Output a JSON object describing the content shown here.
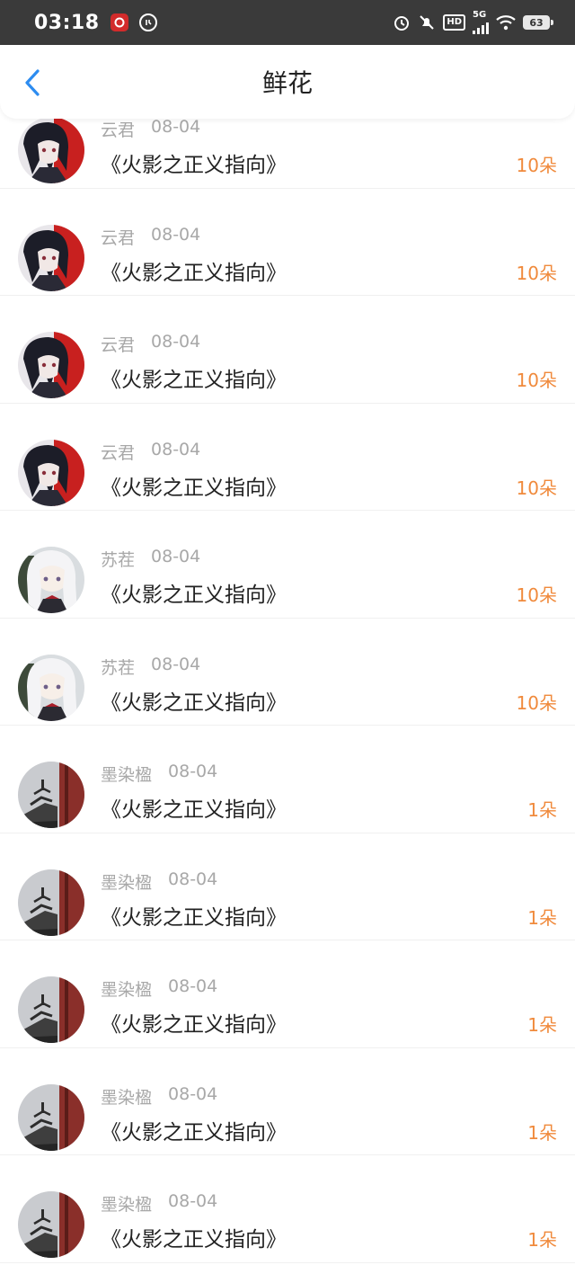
{
  "status_bar": {
    "time": "03:18",
    "battery": "63",
    "network": "5G",
    "hd": "HD",
    "icons": [
      "netease-music-icon",
      "app-icon",
      "alarm-icon",
      "mute-icon",
      "hd-icon",
      "signal-icon",
      "wifi-icon",
      "battery-icon"
    ]
  },
  "nav": {
    "title": "鲜花",
    "back_icon": "chevron-left-icon",
    "accent": "#2d8cf0"
  },
  "colors": {
    "count": "#f08a3c",
    "meta": "#a8a8a8"
  },
  "items": [
    {
      "user": "云君",
      "date": "08-04",
      "book": "《火影之正义指向》",
      "count": "10朵",
      "avatar": "dark-hair-red-avatar"
    },
    {
      "user": "云君",
      "date": "08-04",
      "book": "《火影之正义指向》",
      "count": "10朵",
      "avatar": "dark-hair-red-avatar"
    },
    {
      "user": "云君",
      "date": "08-04",
      "book": "《火影之正义指向》",
      "count": "10朵",
      "avatar": "dark-hair-red-avatar"
    },
    {
      "user": "云君",
      "date": "08-04",
      "book": "《火影之正义指向》",
      "count": "10朵",
      "avatar": "dark-hair-red-avatar"
    },
    {
      "user": "苏茬",
      "date": "08-04",
      "book": "《火影之正义指向》",
      "count": "10朵",
      "avatar": "white-hair-avatar"
    },
    {
      "user": "苏茬",
      "date": "08-04",
      "book": "《火影之正义指向》",
      "count": "10朵",
      "avatar": "white-hair-avatar"
    },
    {
      "user": "墨染楹",
      "date": "08-04",
      "book": "《火影之正义指向》",
      "count": "1朵",
      "avatar": "pagoda-avatar"
    },
    {
      "user": "墨染楹",
      "date": "08-04",
      "book": "《火影之正义指向》",
      "count": "1朵",
      "avatar": "pagoda-avatar"
    },
    {
      "user": "墨染楹",
      "date": "08-04",
      "book": "《火影之正义指向》",
      "count": "1朵",
      "avatar": "pagoda-avatar"
    },
    {
      "user": "墨染楹",
      "date": "08-04",
      "book": "《火影之正义指向》",
      "count": "1朵",
      "avatar": "pagoda-avatar"
    },
    {
      "user": "墨染楹",
      "date": "08-04",
      "book": "《火影之正义指向》",
      "count": "1朵",
      "avatar": "pagoda-avatar"
    }
  ]
}
